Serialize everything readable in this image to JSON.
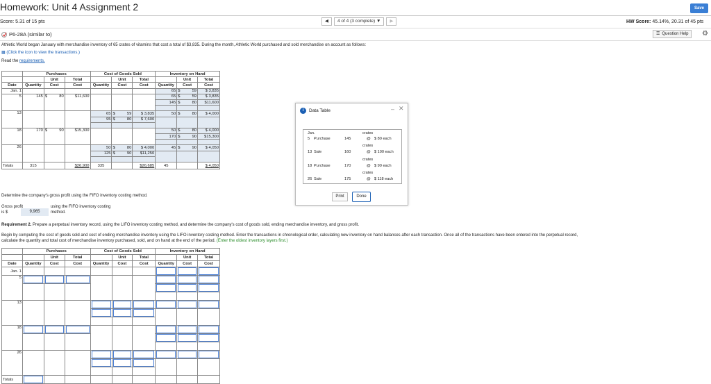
{
  "header": {
    "title": "Homework: Unit 4 Assignment 2",
    "save_label": "Save",
    "score": "Score: 5.31 of 15 pts",
    "nav_prev": "◀",
    "nav_status": "4 of 4 (3 complete) ▼",
    "nav_next": "▶",
    "hw_score_label": "HW Score:",
    "hw_score_value": "45.14%, 20.31 of 45 pts",
    "problem_id": "P6-28A (similar to)",
    "question_help": "Question Help"
  },
  "problem": {
    "intro": "Athletic World began January with merchandise inventory of 65 crates of vitamins that cost a total of $3,835. During the month, Athletic World purchased and sold merchandise on account as follows:",
    "click_icon": "(Click the icon to view the transactions.)",
    "read_prefix": "Read the",
    "read_link": "requirements."
  },
  "table1": {
    "group_headers": [
      "Purchases",
      "Cost of Goods Sold",
      "Inventory on Hand"
    ],
    "sub_headers_top": [
      "",
      "",
      "Unit",
      "Total",
      "",
      "Unit",
      "Total",
      "",
      "Unit",
      "Total"
    ],
    "sub_headers_bottom": [
      "Date",
      "Quantity",
      "Cost",
      "Cost",
      "Quantity",
      "Cost",
      "Cost",
      "Quantity",
      "Cost",
      "Cost"
    ],
    "rows": {
      "jan1_date": "Jan. 1",
      "jan1_inv": [
        "65",
        "$",
        "59",
        "$ 3,835"
      ],
      "d5_date": "5",
      "d5_pur": [
        "145",
        "$",
        "80",
        "$11,600"
      ],
      "d5_inv1": [
        "65",
        "$",
        "59",
        "$ 3,835"
      ],
      "d5_inv2": [
        "145",
        "$",
        "80",
        "$11,600"
      ],
      "d13_date": "13",
      "d13_cogs1": [
        "65",
        "$",
        "59",
        "$ 3,835"
      ],
      "d13_cogs2": [
        "95",
        "$",
        "80",
        "$ 7,600"
      ],
      "d13_inv": [
        "50",
        "$",
        "80",
        "$ 4,000"
      ],
      "d18_date": "18",
      "d18_pur": [
        "170",
        "$",
        "90",
        "$15,300"
      ],
      "d18_inv1": [
        "50",
        "$",
        "80",
        "$ 4,000"
      ],
      "d18_inv2": [
        "170",
        "$",
        "90",
        "$15,300"
      ],
      "d26_date": "26",
      "d26_cogs1": [
        "50",
        "$",
        "80",
        "$ 4,000"
      ],
      "d26_cogs2": [
        "125",
        "$",
        "90",
        "$11,250"
      ],
      "d26_inv": [
        "45",
        "$",
        "90",
        "$ 4,050"
      ],
      "totals_label": "Totals",
      "totals": [
        "315",
        "$26,900",
        "335",
        "$26,685",
        "45",
        "$ 4,050"
      ]
    }
  },
  "gross_profit": {
    "question": "Determine the company's gross profit using the FIFO inventory costing method.",
    "label1": "Gross profit",
    "label2": "is $",
    "value": "9,965",
    "suffix1": "using the FIFO inventory costing",
    "suffix2": "method."
  },
  "requirement2": {
    "title": "Requirement 2.",
    "text": "Prepare a perpetual inventory record, using the LIFO inventory costing method, and determine the company's cost of goods sold, ending merchandise inventory, and gross profit.",
    "instructions1": "Begin by computing the cost of goods sold and cost of ending merchandise inventory using the LIFO inventory costing method. Enter the transactions in chronological order, calculating new inventory on hand balances after each transaction. Once all of the transactions have been entered into the perpetual record,",
    "instructions2": "calculate the quantity and total cost of merchandise inventory purchased, sold, and on hand at the end of the period.",
    "hint": "(Enter the oldest inventory layers first.)"
  },
  "table2": {
    "dates": [
      "Jan. 1",
      "5",
      "13",
      "18",
      "26"
    ],
    "totals_label": "Totals"
  },
  "popup": {
    "title": "Data Table",
    "min": "–",
    "close": "✕",
    "rows": [
      {
        "date": "Jan.",
        "label": "",
        "qty": "",
        "unit": "crates",
        "at": "",
        "price": ""
      },
      {
        "date": "5",
        "label": "Purchase",
        "qty": "145",
        "unit": "",
        "at": "@",
        "price": "$   80 each"
      },
      {
        "date": "",
        "label": "",
        "qty": "",
        "unit": "crates",
        "at": "",
        "price": ""
      },
      {
        "date": "13",
        "label": "Sale",
        "qty": "160",
        "unit": "",
        "at": "@",
        "price": "$ 100 each"
      },
      {
        "date": "",
        "label": "",
        "qty": "",
        "unit": "crates",
        "at": "",
        "price": ""
      },
      {
        "date": "18",
        "label": "Purchase",
        "qty": "170",
        "unit": "",
        "at": "@",
        "price": "$   90 each"
      },
      {
        "date": "",
        "label": "",
        "qty": "",
        "unit": "crates",
        "at": "",
        "price": ""
      },
      {
        "date": "26",
        "label": "Sale",
        "qty": "175",
        "unit": "",
        "at": "@",
        "price": "$ 118 each"
      }
    ],
    "print_label": "Print",
    "done_label": "Done"
  },
  "colors": {
    "accent": "#3a7fd5",
    "input_border": "#4a7fd6",
    "shade": "#e2eaf3"
  }
}
